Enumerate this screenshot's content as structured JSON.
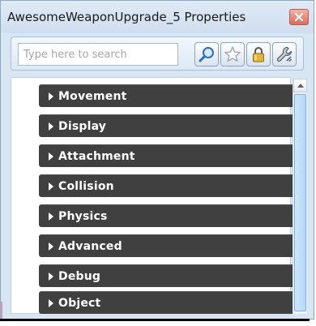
{
  "window": {
    "title": "AwesomeWeaponUpgrade_5 Properties",
    "close_icon": "close-icon"
  },
  "toolbar": {
    "search_placeholder": "Type here to search",
    "buttons": [
      {
        "icon": "search-icon"
      },
      {
        "icon": "star-icon"
      },
      {
        "icon": "lock-icon"
      },
      {
        "icon": "settings-wrench-icon"
      }
    ]
  },
  "categories": [
    {
      "label": "Movement"
    },
    {
      "label": "Display"
    },
    {
      "label": "Attachment"
    },
    {
      "label": "Collision"
    },
    {
      "label": "Physics"
    },
    {
      "label": "Advanced"
    },
    {
      "label": "Debug"
    },
    {
      "label": "Object"
    }
  ],
  "colors": {
    "category_bg": "#404040",
    "window_bg": "#d8e5f3",
    "scroll_thumb": "#b6d7f6"
  }
}
